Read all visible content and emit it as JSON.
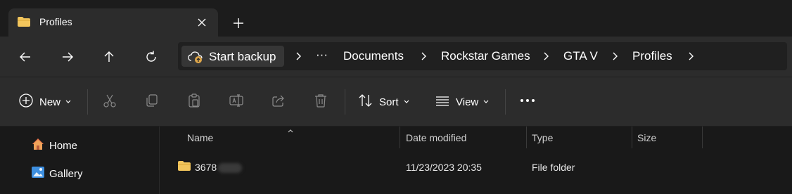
{
  "tab": {
    "title": "Profiles"
  },
  "address": {
    "backup_label": "Start backup",
    "overflow": "···",
    "crumbs": [
      "Documents",
      "Rockstar Games",
      "GTA V",
      "Profiles"
    ]
  },
  "commands": {
    "new_label": "New",
    "sort_label": "Sort",
    "view_label": "View"
  },
  "sidebar": {
    "items": [
      {
        "label": "Home"
      },
      {
        "label": "Gallery"
      }
    ]
  },
  "columns": {
    "name": "Name",
    "date": "Date modified",
    "type": "Type",
    "size": "Size"
  },
  "rows": [
    {
      "name": "3678",
      "date": "11/23/2023 20:35",
      "type": "File folder",
      "size": ""
    }
  ],
  "colors": {
    "background": "#191919",
    "toolbar": "#2c2c2c",
    "folder": "#f2c55c"
  }
}
